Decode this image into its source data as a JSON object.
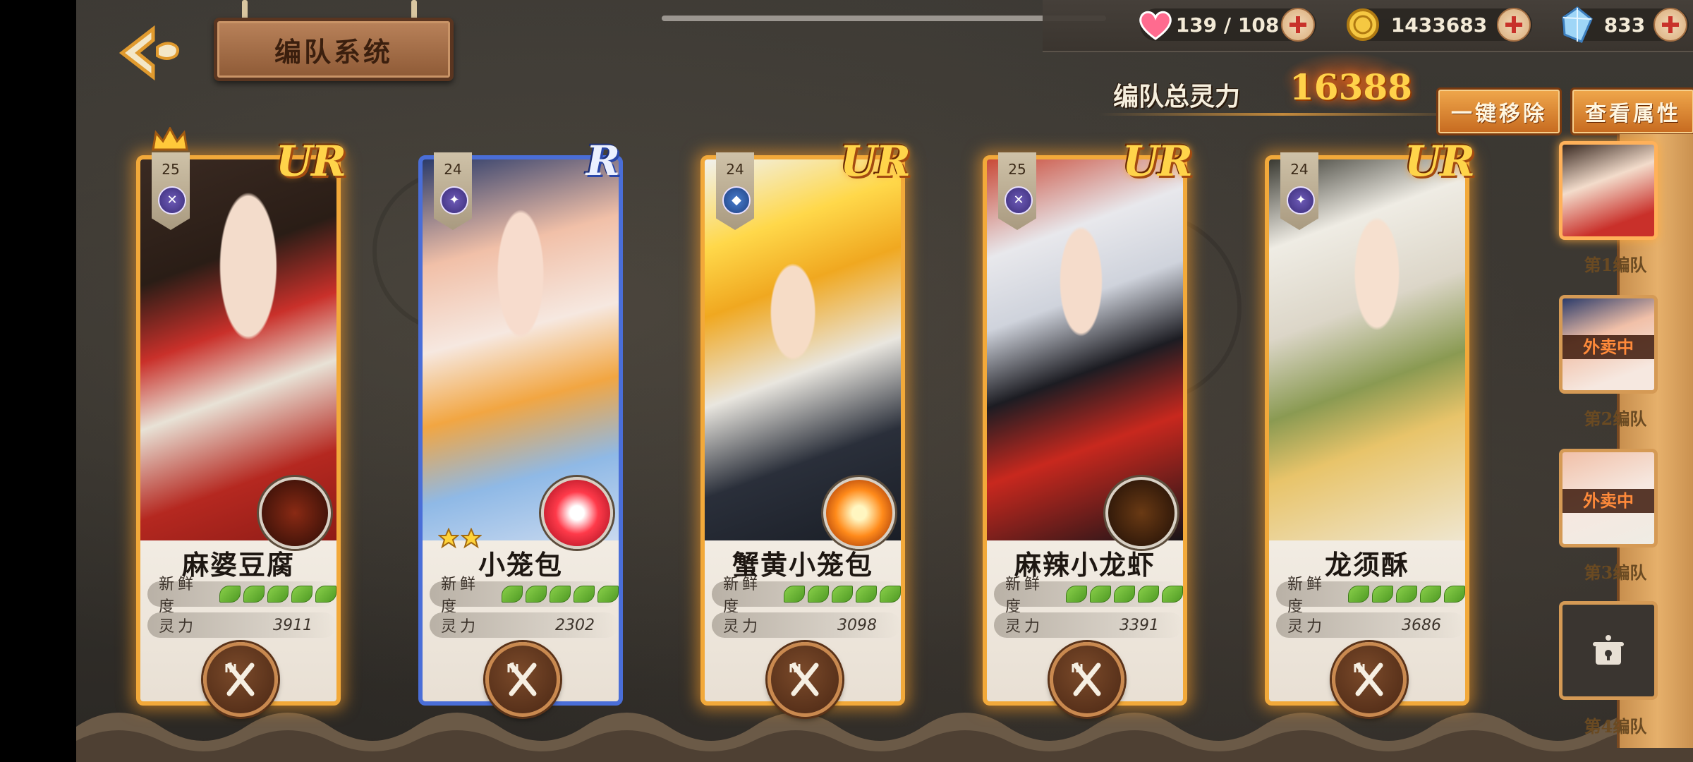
{
  "header": {
    "title": "编队系统",
    "back_label": "back"
  },
  "resources": {
    "stamina": "139 / 108",
    "gold": "1433683",
    "crystal": "833"
  },
  "power": {
    "label": "编队总灵力",
    "value": "16388"
  },
  "actions": {
    "remove_all": "一键移除",
    "view_attributes": "查看属性"
  },
  "labels": {
    "freshness": "新鲜度",
    "spirit": "灵力"
  },
  "cards": [
    {
      "name": "麻婆豆腐",
      "rarity": "UR",
      "level": "25",
      "spirit": "3911",
      "freshness": 5,
      "leader": true
    },
    {
      "name": "小笼包",
      "rarity": "R",
      "level": "24",
      "spirit": "2302",
      "freshness": 5,
      "stars": 2
    },
    {
      "name": "蟹黄小笼包",
      "rarity": "UR",
      "level": "24",
      "spirit": "3098",
      "freshness": 5
    },
    {
      "name": "麻辣小龙虾",
      "rarity": "UR",
      "level": "25",
      "spirit": "3391",
      "freshness": 5
    },
    {
      "name": "龙须酥",
      "rarity": "UR",
      "level": "24",
      "spirit": "3686",
      "freshness": 5
    }
  ],
  "teams": [
    {
      "label": "第1编队",
      "status": ""
    },
    {
      "label": "第2编队",
      "status": "外卖中"
    },
    {
      "label": "第3编队",
      "status": "外卖中"
    },
    {
      "label": "第4编队",
      "status": ""
    }
  ],
  "colors": {
    "ur_border": "#f2a93a",
    "r_border": "#4a6ed8",
    "power_value": "#ffd24a",
    "leaf_green": "#6ab936"
  }
}
